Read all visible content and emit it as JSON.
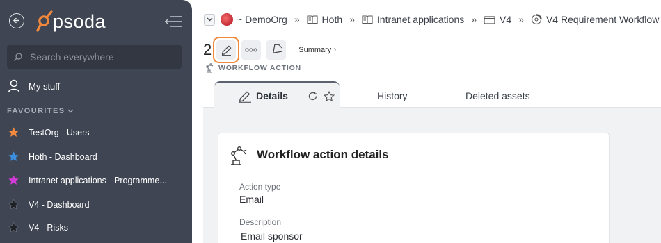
{
  "sidebar": {
    "logo_text": "psoda",
    "search_placeholder": "Search everywhere",
    "my_stuff": "My stuff",
    "favourites_header": "FAVOURITES",
    "favourites": [
      {
        "label": "TestOrg - Users",
        "star_color": "#f0883e"
      },
      {
        "label": "Hoth - Dashboard",
        "star_color": "#3d8ee0"
      },
      {
        "label": "Intranet applications - Programme...",
        "star_color": "#d13ad6"
      },
      {
        "label": "V4 - Dashboard",
        "star_color": "#1e2126"
      },
      {
        "label": "V4 - Risks",
        "star_color": "#1e2126"
      }
    ],
    "background": "#3f4552"
  },
  "breadcrumb": {
    "items": [
      {
        "label": "~ DemoOrg",
        "icon": "org-avatar"
      },
      {
        "label": "Hoth",
        "icon": "book-icon"
      },
      {
        "label": "Intranet applications",
        "icon": "book-icon"
      },
      {
        "label": "V4",
        "icon": "folder-icon"
      },
      {
        "label": "V4 Requirement Workflow",
        "icon": "workflow-icon"
      }
    ],
    "separator": "»"
  },
  "toolbar": {
    "number": "2",
    "summary_link": "Summary ›",
    "highlight_color": "#f0883e"
  },
  "record_type": "WORKFLOW ACTION",
  "tabs": {
    "details": "Details",
    "history": "History",
    "deleted_assets": "Deleted assets"
  },
  "card": {
    "title": "Workflow action details",
    "fields": [
      {
        "label": "Action type",
        "value": "Email"
      },
      {
        "label": "Description",
        "value": "Email sponsor"
      }
    ]
  }
}
